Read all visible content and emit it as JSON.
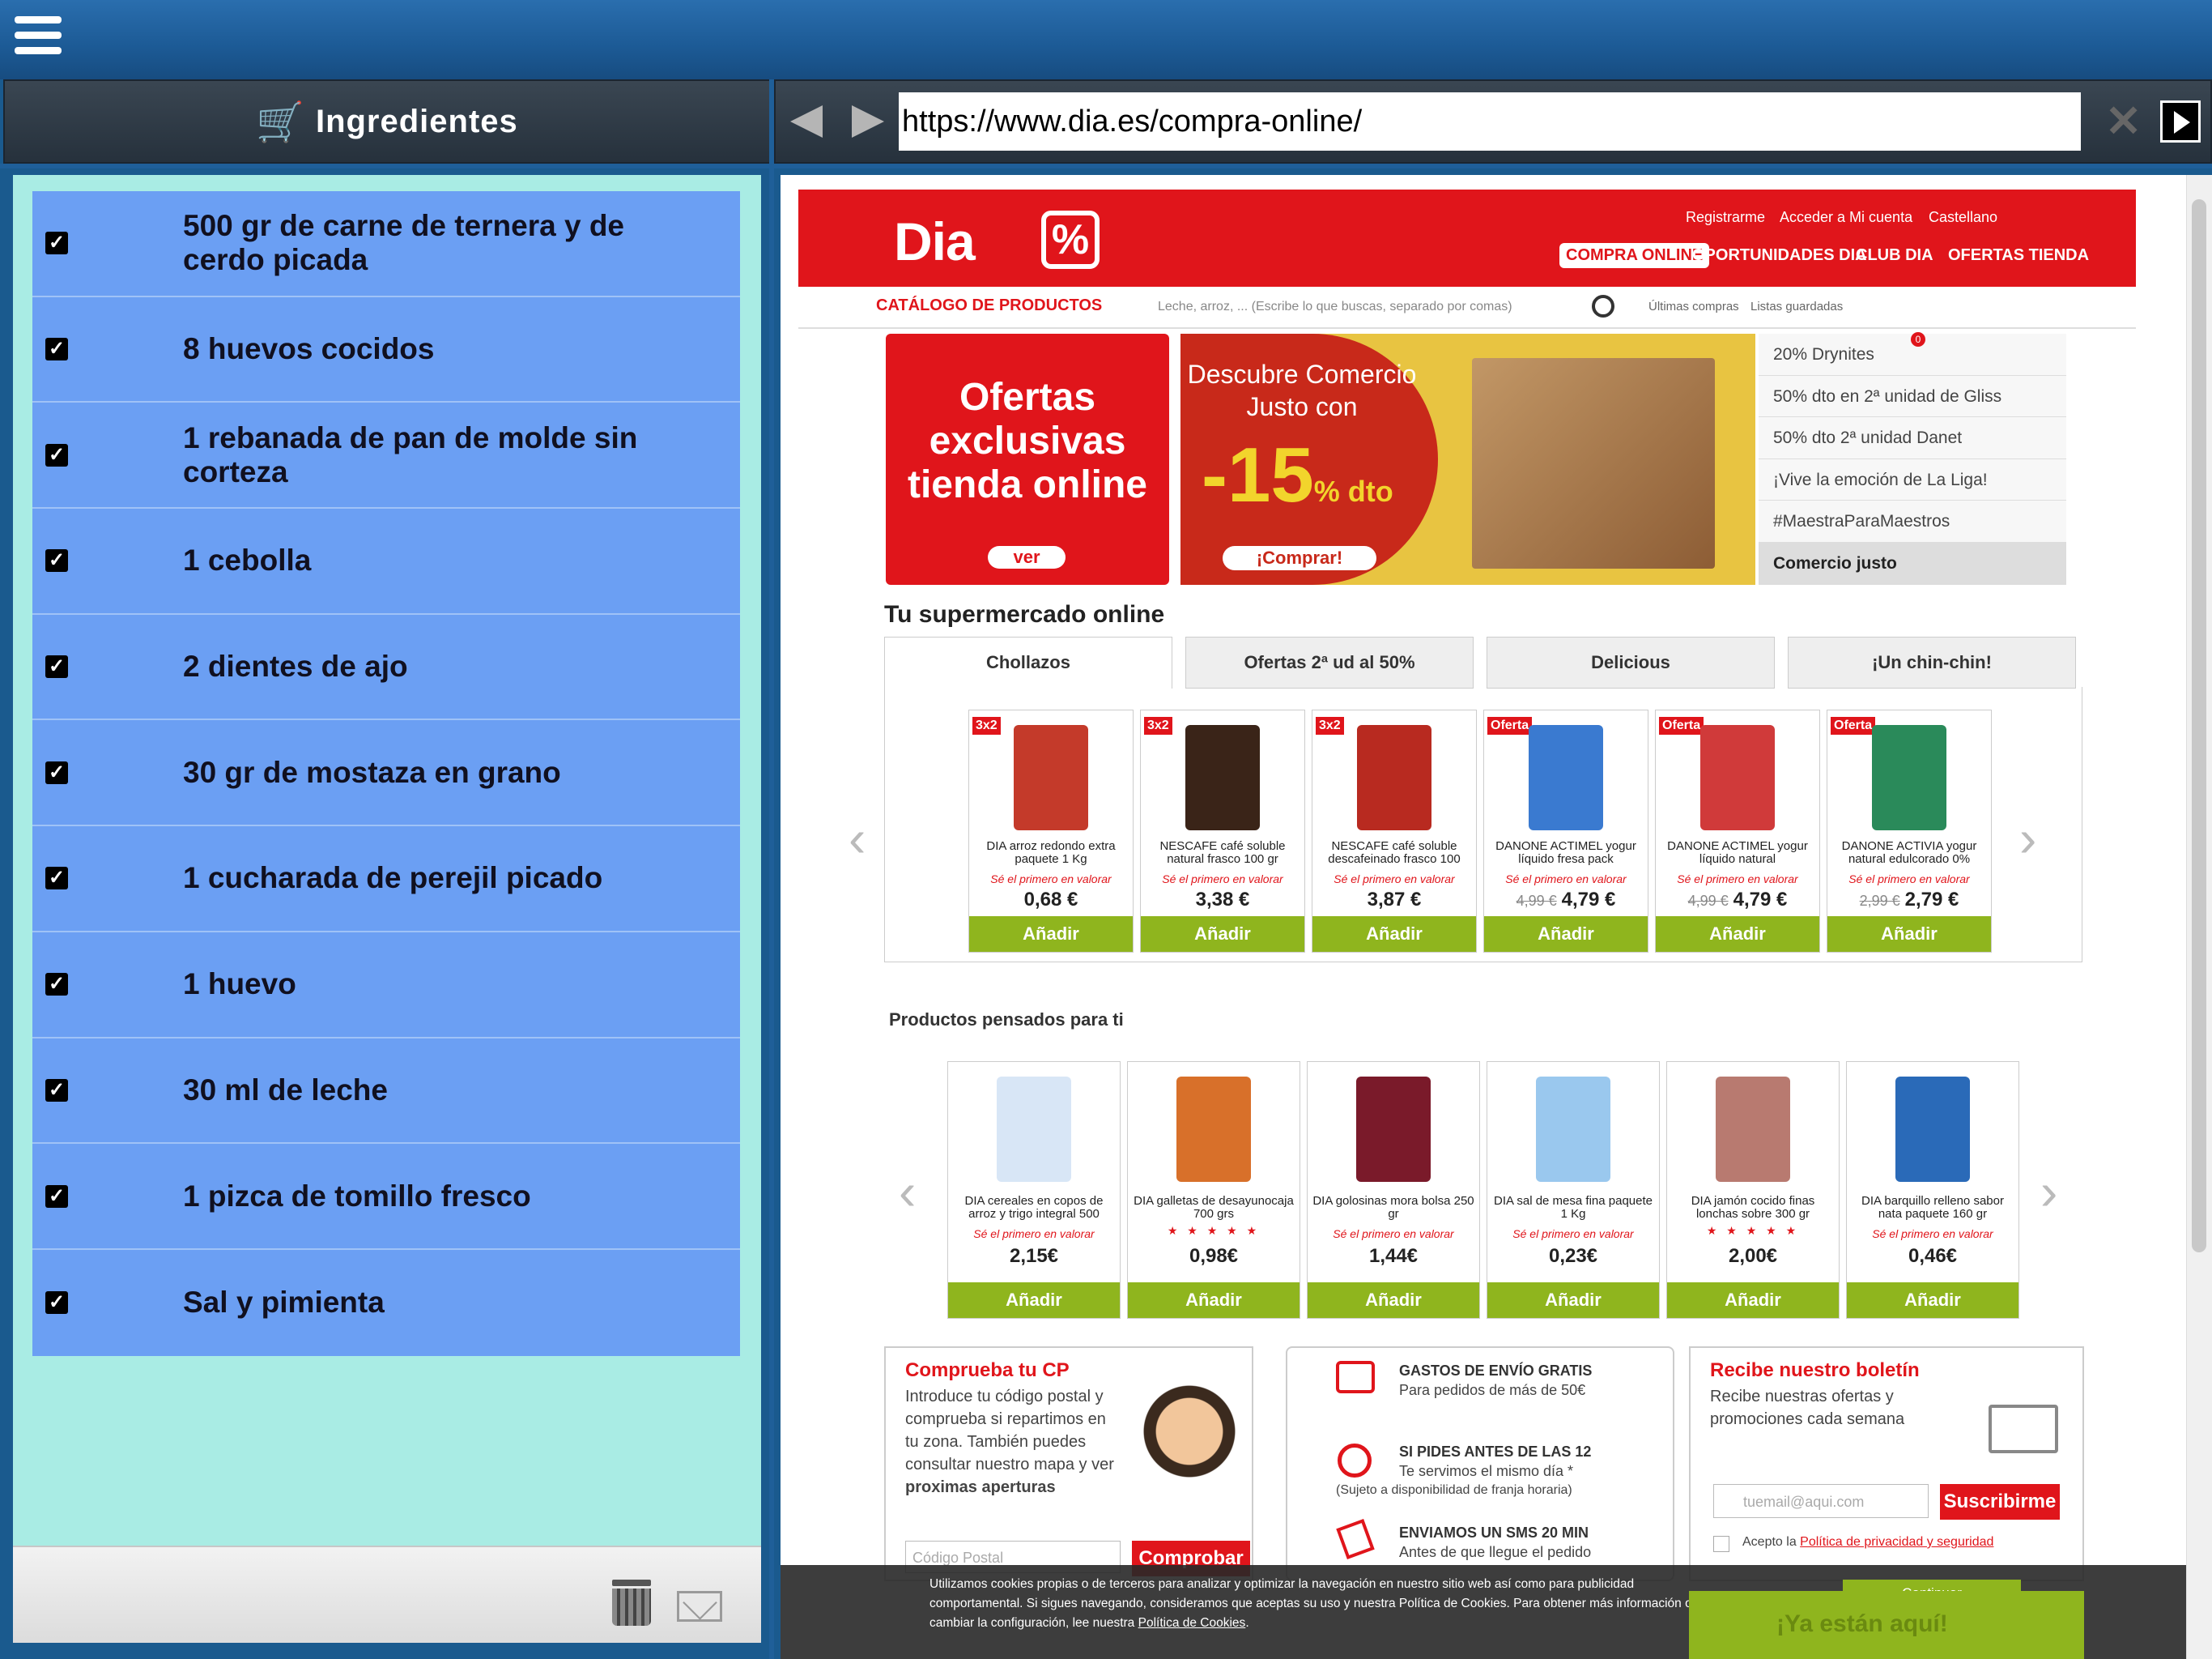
{
  "app": {
    "left_header_title": "Ingredientes",
    "url": "https://www.dia.es/compra-online/"
  },
  "ingredients": [
    "500 gr de carne de ternera y de cerdo picada",
    "8 huevos cocidos",
    "1 rebanada de pan de molde sin corteza",
    "1 cebolla",
    "2 dientes de ajo",
    "30 gr de mostaza en grano",
    "1 cucharada de perejil picado",
    "1 huevo",
    "30 ml de leche",
    "1 pizca de tomillo fresco",
    "Sal y pimienta"
  ],
  "checkbox_mark": "✓",
  "site": {
    "logo": "Dia",
    "logo_mark": "%",
    "top_links": [
      "Registrarme",
      "Acceder a Mi cuenta",
      "Castellano"
    ],
    "nav": [
      "COMPRA ONLINE",
      "OPORTUNIDADES DIA",
      "CLUB DIA",
      "OFERTAS TIENDA"
    ],
    "catalog": "CATÁLOGO DE PRODUCTOS",
    "search_placeholder": "Leche, arroz, ... (Escribe lo que buscas, separado por comas)",
    "shortcuts": [
      "Últimas compras",
      "Listas guardadas"
    ],
    "banner1_text": "Ofertas exclusivas tienda online",
    "banner1_btn": "ver",
    "banner2_text": "Descubre Comercio Justo con",
    "banner2_big": "-15",
    "banner2_pct": "% dto",
    "banner2_btn": "¡Comprar!",
    "side_items": [
      "20% Drynites",
      "50% dto en 2ª unidad de Gliss",
      "50% dto 2ª unidad Danet",
      "¡Vive la emoción de La Liga!",
      "#MaestraParaMaestros",
      "Comercio justo"
    ],
    "side_badge": "0",
    "section_title": "Tu supermercado online",
    "tabs": [
      "Chollazos",
      "Ofertas 2ª ud al 50%",
      "Delicious",
      "¡Un chin-chin!"
    ],
    "products1": [
      {
        "tag": "3x2",
        "name": "DIA arroz redondo extra paquete 1 Kg",
        "rate": "Sé el primero en valorar",
        "old": "",
        "price": "0,68 €",
        "add": "Añadir",
        "color": "#c43a2a"
      },
      {
        "tag": "3x2",
        "name": "NESCAFE café soluble natural frasco 100 gr",
        "rate": "Sé el primero en valorar",
        "old": "",
        "price": "3,38 €",
        "add": "Añadir",
        "color": "#3a2418"
      },
      {
        "tag": "3x2",
        "name": "NESCAFE café soluble descafeinado frasco 100",
        "rate": "Sé el primero en valorar",
        "old": "",
        "price": "3,87 €",
        "add": "Añadir",
        "color": "#b82a20"
      },
      {
        "tag": "Oferta",
        "name": "DANONE ACTIMEL yogur líquido fresa pack",
        "rate": "Sé el primero en valorar",
        "old": "4,99 €",
        "price": "4,79 €",
        "add": "Añadir",
        "color": "#3a7ad0"
      },
      {
        "tag": "Oferta",
        "name": "DANONE ACTIMEL yogur líquido natural",
        "rate": "Sé el primero en valorar",
        "old": "4,99 €",
        "price": "4,79 €",
        "add": "Añadir",
        "color": "#d03a3a"
      },
      {
        "tag": "Oferta",
        "name": "DANONE ACTIVIA yogur natural edulcorado 0%",
        "rate": "Sé el primero en valorar",
        "old": "2,99 €",
        "price": "2,79 €",
        "add": "Añadir",
        "color": "#2a8a5a"
      }
    ],
    "section2_title": "Productos pensados para ti",
    "products2": [
      {
        "name": "DIA cereales en copos de arroz y trigo integral 500",
        "rate": "Sé el primero en valorar",
        "stars": "",
        "price": "2,15€",
        "add": "Añadir",
        "color": "#d8e6f6"
      },
      {
        "name": "DIA galletas de desayunocaja 700 grs",
        "rate": "",
        "stars": "★ ★ ★ ★ ★",
        "price": "0,98€",
        "add": "Añadir",
        "color": "#d8702a"
      },
      {
        "name": "DIA golosinas mora bolsa 250 gr",
        "rate": "Sé el primero en valorar",
        "stars": "",
        "price": "1,44€",
        "add": "Añadir",
        "color": "#7a1a2a"
      },
      {
        "name": "DIA sal de mesa fina paquete 1 Kg",
        "rate": "Sé el primero en valorar",
        "stars": "",
        "price": "0,23€",
        "add": "Añadir",
        "color": "#9ac8ee"
      },
      {
        "name": "DIA jamón cocido finas lonchas sobre 300 gr",
        "rate": "",
        "stars": "★ ★ ★ ★ ★",
        "price": "2,00€",
        "add": "Añadir",
        "color": "#b87a70"
      },
      {
        "name": "DIA barquillo relleno sabor nata paquete 160 gr",
        "rate": "Sé el primero en valorar",
        "stars": "",
        "price": "0,46€",
        "add": "Añadir",
        "color": "#2a6ab8"
      }
    ],
    "cp_title": "Comprueba tu CP",
    "cp_text": "Introduce tu código postal y comprueba si repartimos en tu zona. También puedes consultar nuestro mapa y ver",
    "cp_text_bold": "proximas aperturas",
    "cp_placeholder": "Código Postal",
    "cp_btn": "Comprobar",
    "info1_title": "GASTOS DE ENVÍO GRATIS",
    "info1_text": "Para pedidos de más de 50€",
    "info2_title": "SI PIDES ANTES DE LAS 12",
    "info2_text": "Te servimos el mismo día *",
    "info2_sub": "(Sujeto a disponibilidad de franja horaria)",
    "info3_title": "ENVIAMOS UN SMS 20 MIN",
    "info3_text": "Antes de que llegue el pedido",
    "news_title": "Recibe nuestro boletín",
    "news_text": "Recibe nuestras ofertas y promociones cada semana",
    "news_placeholder": "tuemail@aqui.com",
    "news_btn": "Suscribirme",
    "news_accept": "Acepto la",
    "news_link": "Política de privacidad y seguridad",
    "cookie_text": "Utilizamos cookies propias o de terceros para analizar y optimizar la navegación en nuestro sitio web así como para publicidad comportamental. Si sigues navegando, consideramos que aceptas su uso y nuestra Política de Cookies. Para obtener más información o cambiar la configuración, lee nuestra",
    "cookie_link": "Política de Cookies",
    "cookie_btn": "Continuar",
    "bottom_text": "¡Ya están aquí!"
  }
}
